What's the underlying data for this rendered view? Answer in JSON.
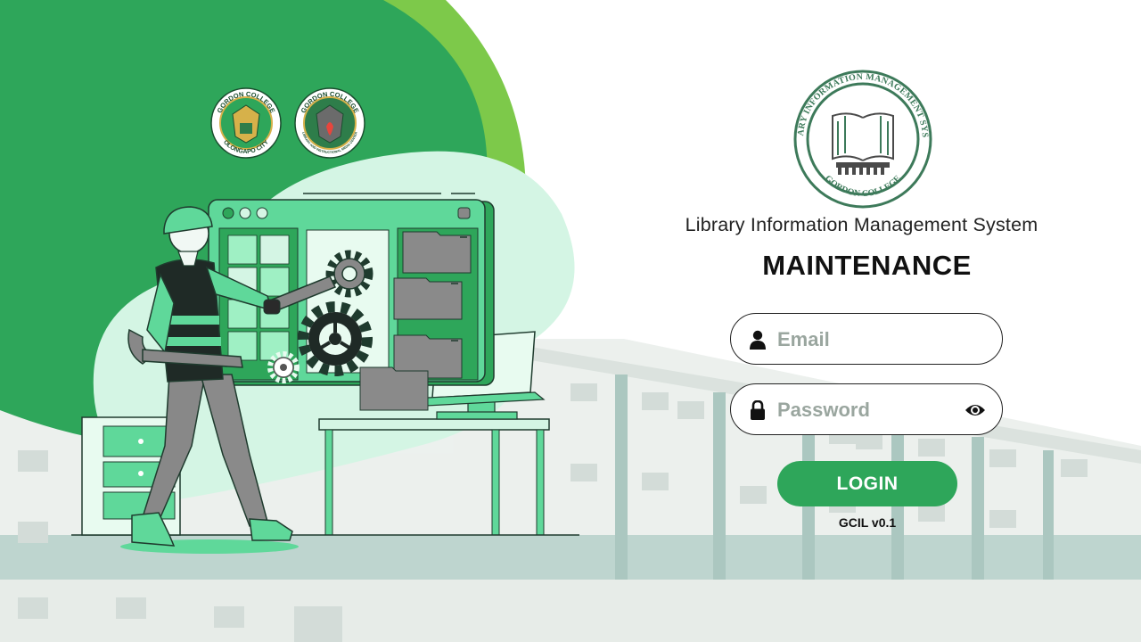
{
  "header": {
    "system_title": "Library Information Management System",
    "page_title": "MAINTENANCE",
    "system_logo": {
      "ring_text": "LIBRARY INFORMATION MANAGEMENT SYSTEM",
      "bottom_text": "GORDON COLLEGE"
    }
  },
  "college_logos": [
    {
      "top_text": "GORDON COLLEGE",
      "bottom_text": "OLONGAPO CITY"
    },
    {
      "top_text": "GORDON COLLEGE",
      "bottom_text": "LIBRARY AND INSTRUCTIONAL MEDIA CENTER"
    }
  ],
  "form": {
    "email": {
      "placeholder": "Email",
      "value": ""
    },
    "password": {
      "placeholder": "Password",
      "value": ""
    },
    "login_label": "LOGIN"
  },
  "footer": {
    "version": "GCIL v0.1"
  },
  "icons": {
    "email": "user-icon",
    "password": "lock-icon",
    "toggle": "eye-icon"
  },
  "colors": {
    "primary_green": "#2ea65a",
    "light_green": "#7dc94a",
    "mint": "#d4f5e4",
    "illustration_green": "#5fd89a"
  }
}
